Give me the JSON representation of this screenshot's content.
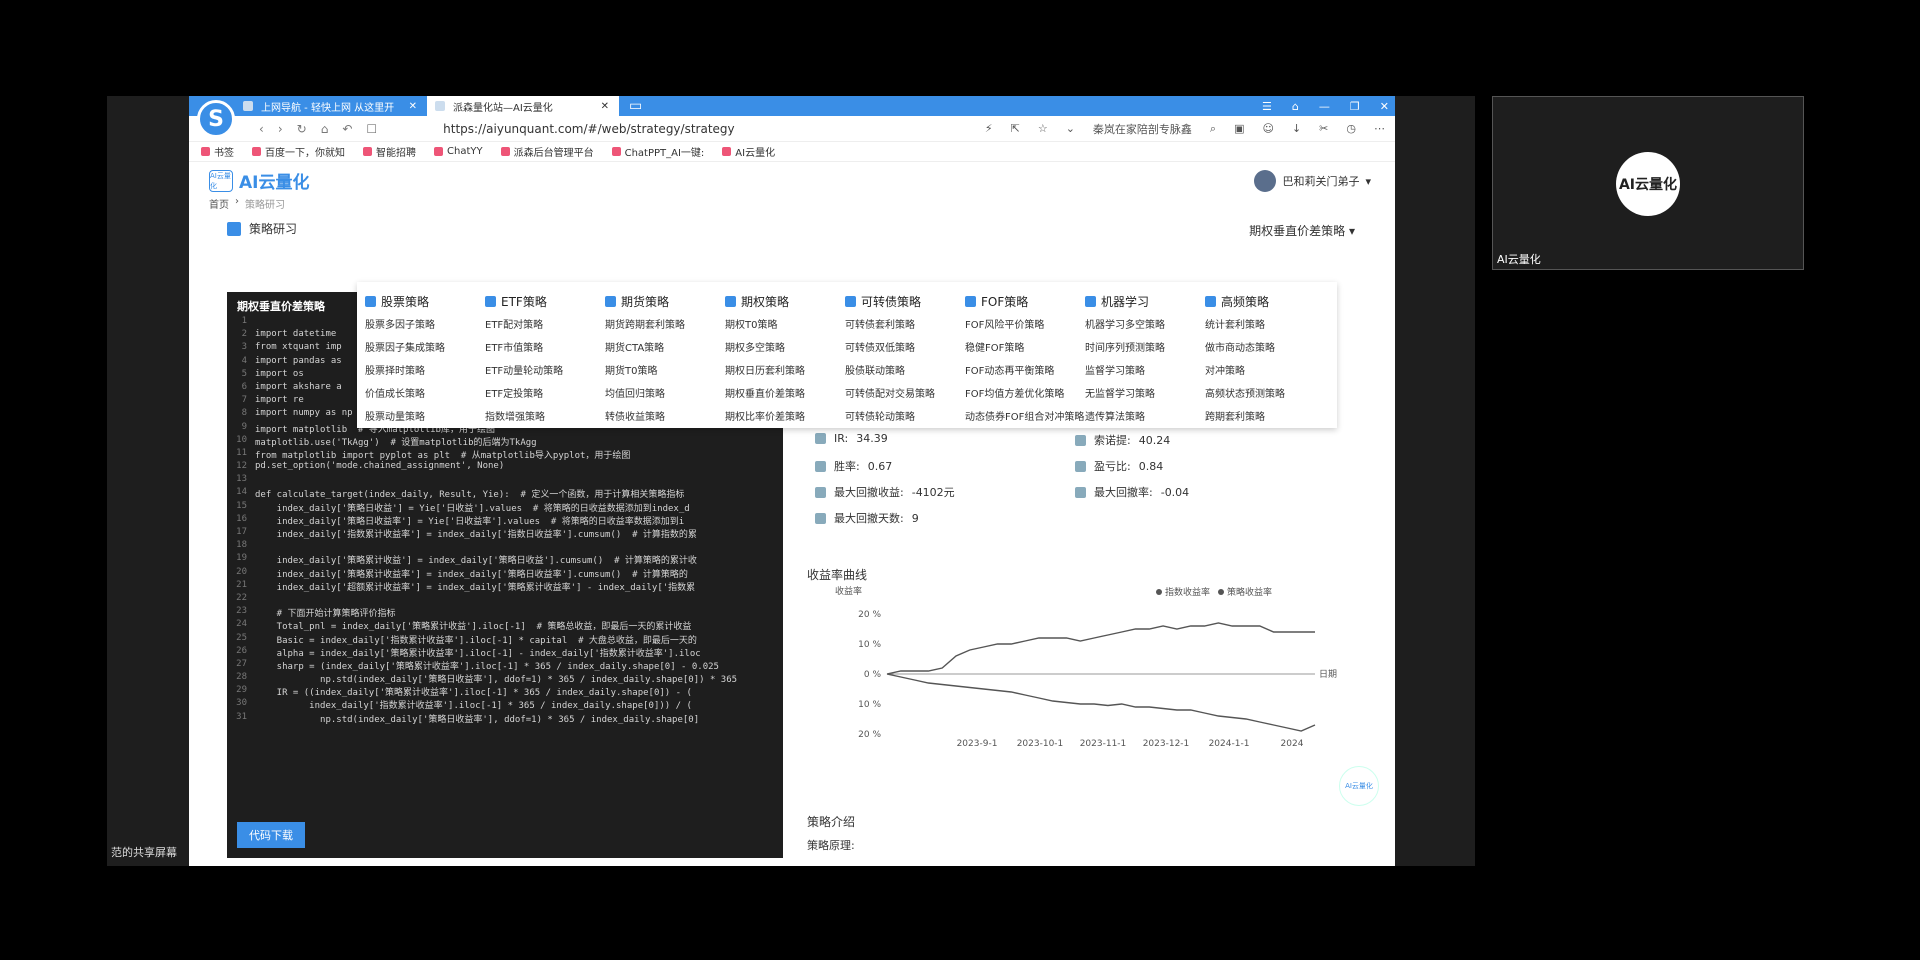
{
  "share_label": "范的共享屏幕",
  "tabs": [
    {
      "label": "上网导航 - 轻快上网 从这里开"
    },
    {
      "label": "派森量化站—AI云量化"
    }
  ],
  "address": {
    "url": "https://aiyunquant.com/#/web/strategy/strategy",
    "search_hint": "秦岚在家陪剖专脉鑫"
  },
  "bookmarks": [
    "书签",
    "百度一下，你就知",
    "智能招聘",
    "ChatYY",
    "派森后台管理平台",
    "ChatPPT_AI一键:",
    "AI云量化"
  ],
  "site": {
    "logo_text": "AI云量化",
    "logo_badge": "AI云量化",
    "user_name": "巴和莉关门弟子"
  },
  "breadcrumb": {
    "home": "首页",
    "current": "策略研习"
  },
  "section": {
    "title": "策略研习",
    "selected_strategy": "期权垂直价差策略"
  },
  "editor": {
    "title": "期权垂直价差策略",
    "download_label": "代码下载",
    "lines": [
      {
        "n": "1",
        "code": ""
      },
      {
        "n": "2",
        "code": "import datetime"
      },
      {
        "n": "3",
        "code": "from xtquant imp"
      },
      {
        "n": "4",
        "code": "import pandas as"
      },
      {
        "n": "5",
        "code": "import os"
      },
      {
        "n": "6",
        "code": "import akshare a"
      },
      {
        "n": "7",
        "code": "import re"
      },
      {
        "n": "8",
        "code": "import numpy as np"
      },
      {
        "n": "9",
        "code": "import matplotlib  # 导入matplotlib库，用于绘图"
      },
      {
        "n": "10",
        "code": "matplotlib.use('TkAgg')  # 设置matplotlib的后端为TkAgg"
      },
      {
        "n": "11",
        "code": "from matplotlib import pyplot as plt  # 从matplotlib导入pyplot，用于绘图"
      },
      {
        "n": "12",
        "code": "pd.set_option('mode.chained_assignment', None)"
      },
      {
        "n": "13",
        "code": ""
      },
      {
        "n": "14",
        "code": "def calculate_target(index_daily, Result, Yie):  # 定义一个函数，用于计算相关策略指标"
      },
      {
        "n": "15",
        "code": "    index_daily['策略日收益'] = Yie['日收益'].values  # 将策略的日收益数据添加到index_d"
      },
      {
        "n": "16",
        "code": "    index_daily['策略日收益率'] = Yie['日收益率'].values  # 将策略的日收益率数据添加到i"
      },
      {
        "n": "17",
        "code": "    index_daily['指数累计收益率'] = index_daily['指数日收益率'].cumsum()  # 计算指数的累"
      },
      {
        "n": "18",
        "code": ""
      },
      {
        "n": "19",
        "code": "    index_daily['策略累计收益'] = index_daily['策略日收益'].cumsum()  # 计算策略的累计收"
      },
      {
        "n": "20",
        "code": "    index_daily['策略累计收益率'] = index_daily['策略日收益率'].cumsum()  # 计算策略的"
      },
      {
        "n": "21",
        "code": "    index_daily['超额累计收益率'] = index_daily['策略累计收益率'] - index_daily['指数累"
      },
      {
        "n": "22",
        "code": ""
      },
      {
        "n": "23",
        "code": "    # 下面开始计算策略评价指标"
      },
      {
        "n": "24",
        "code": "    Total_pnl = index_daily['策略累计收益'].iloc[-1]  # 策略总收益，即最后一天的累计收益"
      },
      {
        "n": "25",
        "code": "    Basic = index_daily['指数累计收益率'].iloc[-1] * capital  # 大盘总收益，即最后一天的"
      },
      {
        "n": "26",
        "code": "    alpha = index_daily['策略累计收益率'].iloc[-1] - index_daily['指数累计收益率'].iloc"
      },
      {
        "n": "27",
        "code": "    sharp = (index_daily['策略累计收益率'].iloc[-1] * 365 / index_daily.shape[0] - 0.025"
      },
      {
        "n": "28",
        "code": "            np.std(index_daily['策略日收益率'], ddof=1) * 365 / index_daily.shape[0]) * 365"
      },
      {
        "n": "29",
        "code": "    IR = ((index_daily['策略累计收益率'].iloc[-1] * 365 / index_daily.shape[0]) - ("
      },
      {
        "n": "30",
        "code": "          index_daily['指数累计收益率'].iloc[-1] * 365 / index_daily.shape[0])) / ("
      },
      {
        "n": "31",
        "code": "            np.std(index_daily['策略日收益率'], ddof=1) * 365 / index_daily.shape[0]"
      }
    ]
  },
  "menu": [
    {
      "head": "股票策略",
      "items": [
        "股票多因子策略",
        "股票因子集成策略",
        "股票择时策略",
        "价值成长策略",
        "股票动量策略"
      ]
    },
    {
      "head": "ETF策略",
      "items": [
        "ETF配对策略",
        "ETF市值策略",
        "ETF动量轮动策略",
        "ETF定投策略",
        "指数增强策略"
      ]
    },
    {
      "head": "期货策略",
      "items": [
        "期货跨期套利策略",
        "期货CTA策略",
        "期货T0策略",
        "均值回归策略",
        "转债收益策略"
      ]
    },
    {
      "head": "期权策略",
      "items": [
        "期权T0策略",
        "期权多空策略",
        "期权日历套利策略",
        "期权垂直价差策略",
        "期权比率价差策略"
      ]
    },
    {
      "head": "可转债策略",
      "items": [
        "可转债套利策略",
        "可转债双低策略",
        "股债联动策略",
        "可转债配对交易策略",
        "可转债轮动策略"
      ]
    },
    {
      "head": "FOF策略",
      "items": [
        "FOF风险平价策略",
        "稳健FOF策略",
        "FOF动态再平衡策略",
        "FOF均值方差优化策略",
        "动态债券FOF组合对冲策略"
      ]
    },
    {
      "head": "机器学习",
      "items": [
        "机器学习多空策略",
        "时间序列预测策略",
        "监督学习策略",
        "无监督学习策略",
        "遗传算法策略"
      ]
    },
    {
      "head": "高频策略",
      "items": [
        "统计套利策略",
        "做市商动态策略",
        "对冲策略",
        "高频状态预测策略",
        "跨期套利策略"
      ]
    }
  ],
  "metrics": [
    {
      "label": "IR:",
      "value": "34.39"
    },
    {
      "label": "索诺提:",
      "value": "40.24"
    },
    {
      "label": "胜率:",
      "value": "0.67"
    },
    {
      "label": "盈亏比:",
      "value": "0.84"
    },
    {
      "label": "最大回撤收益:",
      "value": "-4102元"
    },
    {
      "label": "最大回撤率:",
      "value": "-0.04"
    },
    {
      "label": "最大回撤天数:",
      "value": "9"
    }
  ],
  "chart_data": {
    "type": "line",
    "title": "收益率曲线",
    "ylabel": "收益率",
    "xlabel": "日期",
    "y_ticks": [
      "20 %",
      "10 %",
      "0 %",
      "10 %",
      "20 %"
    ],
    "x_ticks": [
      "2023-9-1",
      "2023-10-1",
      "2023-11-1",
      "2023-12-1",
      "2024-1-1",
      "2024"
    ],
    "ylim": [
      -20,
      20
    ],
    "legend": "top-right",
    "series": [
      {
        "name": "指数收益率",
        "color": "#555555",
        "values": [
          0,
          -1,
          -2,
          -3,
          -3.5,
          -4,
          -4.5,
          -5,
          -5.5,
          -6,
          -7,
          -8,
          -9,
          -9.5,
          -10,
          -10,
          -10.5,
          -10,
          -11,
          -11,
          -11.5,
          -12,
          -12,
          -13,
          -14,
          -14.5,
          -15,
          -16,
          -17,
          -18,
          -19,
          -17
        ]
      },
      {
        "name": "策略收益率",
        "color": "#555555",
        "values": [
          0,
          1,
          1,
          1,
          2,
          6,
          8,
          9,
          10,
          10,
          11,
          12,
          12,
          12,
          11,
          12,
          13,
          14,
          15,
          15,
          16,
          15,
          16,
          16,
          17,
          16,
          16,
          16,
          14,
          14,
          14,
          14
        ]
      }
    ]
  },
  "intro": {
    "title": "策略介绍",
    "principle_label": "策略原理:"
  },
  "right_panel": {
    "logo_text": "AI云量化",
    "label": "AI云量化"
  },
  "watermark": "AI云量化"
}
